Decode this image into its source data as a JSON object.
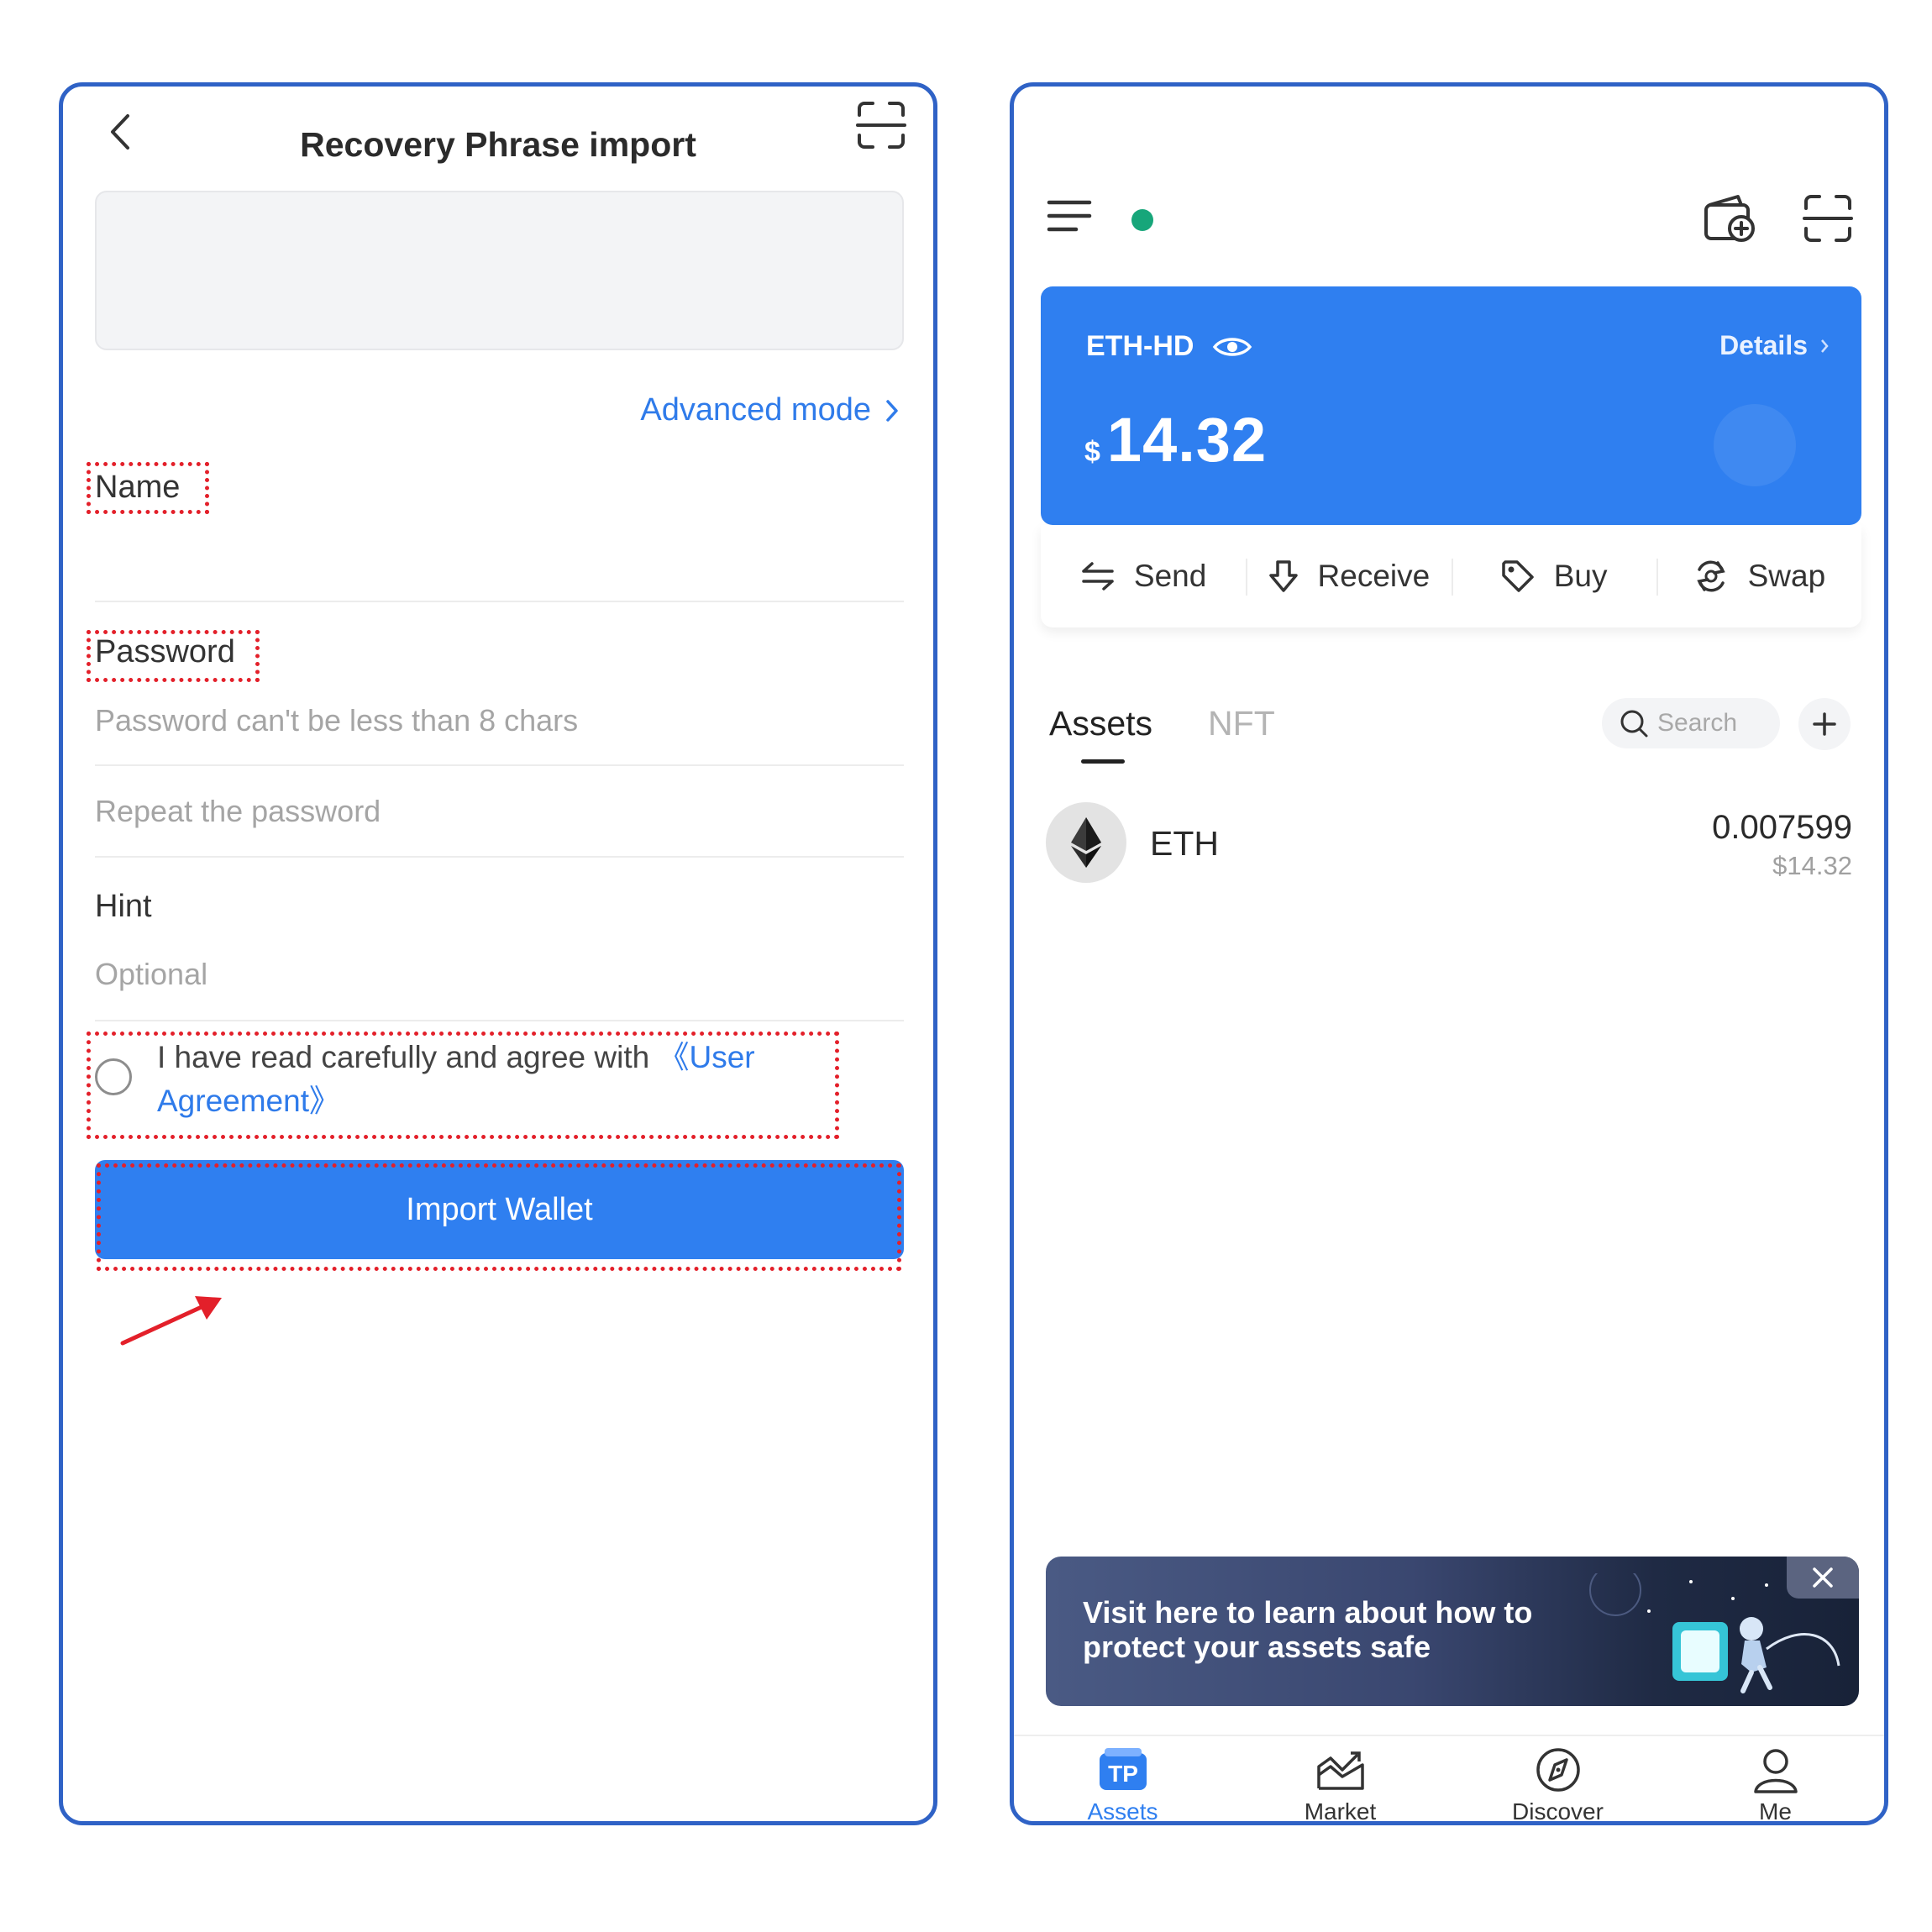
{
  "left": {
    "title": "Recovery Phrase import",
    "advanced_mode_label": "Advanced mode",
    "name_label": "Name",
    "password_label": "Password",
    "password_placeholder": "Password can't be less than 8 chars",
    "repeat_placeholder": "Repeat the password",
    "hint_label": "Hint",
    "hint_placeholder": "Optional",
    "agreement_text": "I have read carefully and agree with",
    "agreement_link": "《User Agreement》",
    "import_button": "Import Wallet"
  },
  "right": {
    "wallet_name": "ETH-HD",
    "details_label": "Details",
    "currency_symbol": "$",
    "balance": "14.32",
    "actions": [
      {
        "label": "Send",
        "icon": "send-icon"
      },
      {
        "label": "Receive",
        "icon": "receive-icon"
      },
      {
        "label": "Buy",
        "icon": "tag-icon"
      },
      {
        "label": "Swap",
        "icon": "swap-icon"
      }
    ],
    "tabs": [
      "Assets",
      "NFT"
    ],
    "search_placeholder": "Search",
    "assets": [
      {
        "symbol": "ETH",
        "amount": "0.007599",
        "value": "$14.32"
      }
    ],
    "banner_text": "Visit here to learn about how to protect your assets safe",
    "nav": [
      {
        "label": "Assets",
        "icon": "tp-icon",
        "active": true
      },
      {
        "label": "Market",
        "icon": "market-chart-icon",
        "active": false
      },
      {
        "label": "Discover",
        "icon": "compass-icon",
        "active": false
      },
      {
        "label": "Me",
        "icon": "user-icon",
        "active": false
      }
    ]
  },
  "colors": {
    "accent": "#2f7ff0",
    "link": "#2f7bea",
    "frame": "#2f62c6",
    "highlight": "#e3202a",
    "status_dot": "#17a67a"
  }
}
